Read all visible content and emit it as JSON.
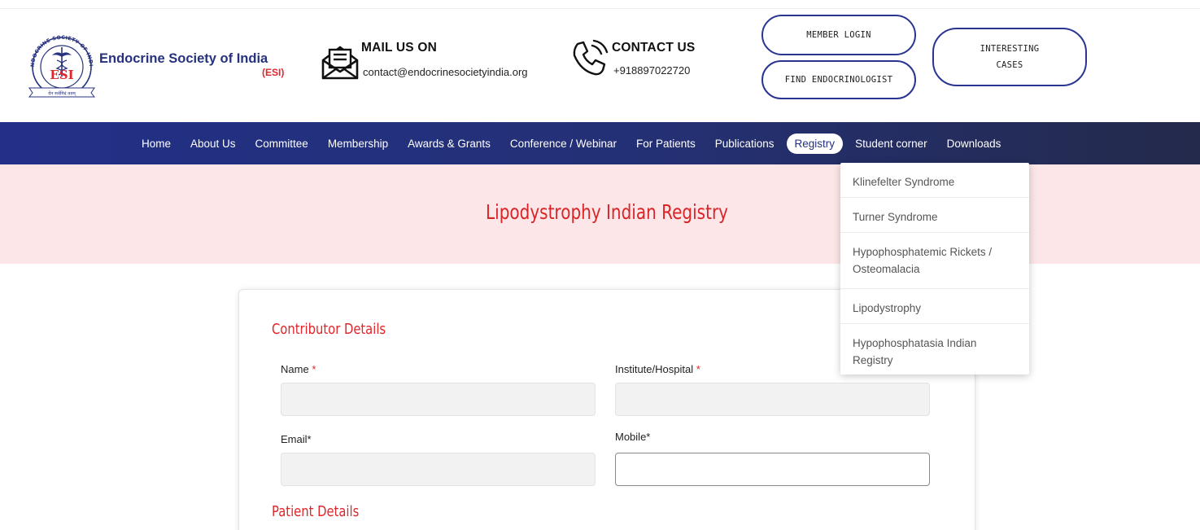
{
  "brand": {
    "name": "Endocrine Society of India",
    "abbr": "(ESI)",
    "logo": {
      "ring_text": "ENDOCRINE SOCIETY OF INDIA",
      "center_text": "ESI",
      "motto": "येन सर्वमिदं ततम्",
      "primary_color": "#26327d",
      "accent_color": "#e0262b"
    }
  },
  "contact": {
    "mail": {
      "icon": "envelope-icon",
      "title": "MAIL US ON",
      "value": "contact@endocrinesocietyindia.org"
    },
    "phone": {
      "icon": "phone-icon",
      "title": "CONTACT US",
      "value": "+918897022720"
    }
  },
  "buttons": {
    "member_login": "MEMBER LOGIN",
    "find_endocrinologist": "FIND ENDOCRINOLOGIST",
    "interesting_cases_line1": "INTERESTING",
    "interesting_cases_line2": "CASES"
  },
  "nav": {
    "items": [
      "Home",
      "About Us",
      "Committee",
      "Membership",
      "Awards & Grants",
      "Conference / Webinar",
      "For Patients",
      "Publications",
      "Registry",
      "Student corner",
      "Downloads"
    ],
    "active": "Registry"
  },
  "registry_dropdown": {
    "items": [
      "Klinefelter Syndrome",
      "Turner Syndrome",
      "Hypophosphatemic Rickets / Osteomalacia",
      "Lipodystrophy",
      "Hypophosphatasia Indian Registry"
    ]
  },
  "banner": {
    "title": "Lipodystrophy Indian Registry"
  },
  "form": {
    "contributor_title": "Contributor Details",
    "patient_title": "Patient Details",
    "fields": {
      "name": {
        "label": "Name",
        "required_mark": "*"
      },
      "institute": {
        "label": "Institute/Hospital",
        "required_mark": "*"
      },
      "email": {
        "label": "Email*"
      },
      "mobile": {
        "label": "Mobile*"
      }
    }
  },
  "colors": {
    "nav_bg": "#223088",
    "banner_bg": "#fde6e7",
    "heading_red": "#d92428",
    "pill_border": "#2a3592"
  }
}
